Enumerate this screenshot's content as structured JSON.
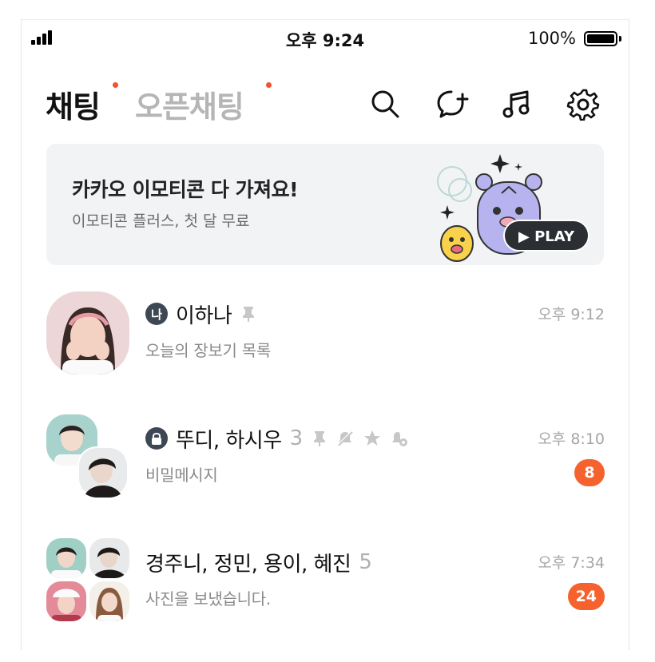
{
  "status_bar": {
    "time": "오후 9:24",
    "battery": "100%"
  },
  "header": {
    "tabs": [
      {
        "label": "채팅",
        "active": true
      },
      {
        "label": "오픈채팅",
        "active": false
      }
    ],
    "icons": [
      "search-icon",
      "new-chat-icon",
      "music-icon",
      "settings-icon"
    ],
    "dot_color": "#f5512b"
  },
  "banner": {
    "title": "카카오 이모티콘 다 가져요!",
    "subtitle": "이모티콘 플러스, 첫 달 무료",
    "play_label": "PLAY"
  },
  "chats": [
    {
      "badge": "나",
      "name": "이하나",
      "count": "",
      "icons": [
        "pin-icon"
      ],
      "preview": "오늘의 장보기 목록",
      "time": "오후 9:12",
      "unread": ""
    },
    {
      "badge_icon": "lock-icon",
      "name": "뚜디, 하시우",
      "count": "3",
      "icons": [
        "pin-icon",
        "mute-icon",
        "star-icon",
        "bell-icon"
      ],
      "preview": "비밀메시지",
      "time": "오후 8:10",
      "unread": "8"
    },
    {
      "name": "경주니, 정민, 용이, 혜진",
      "count": "5",
      "icons": [],
      "preview": "사진을 보냈습니다.",
      "time": "오후 7:34",
      "unread": "24"
    }
  ],
  "colors": {
    "accent": "#f5622d",
    "badge_dark": "#3e4754",
    "muted": "#a6a6a6"
  }
}
